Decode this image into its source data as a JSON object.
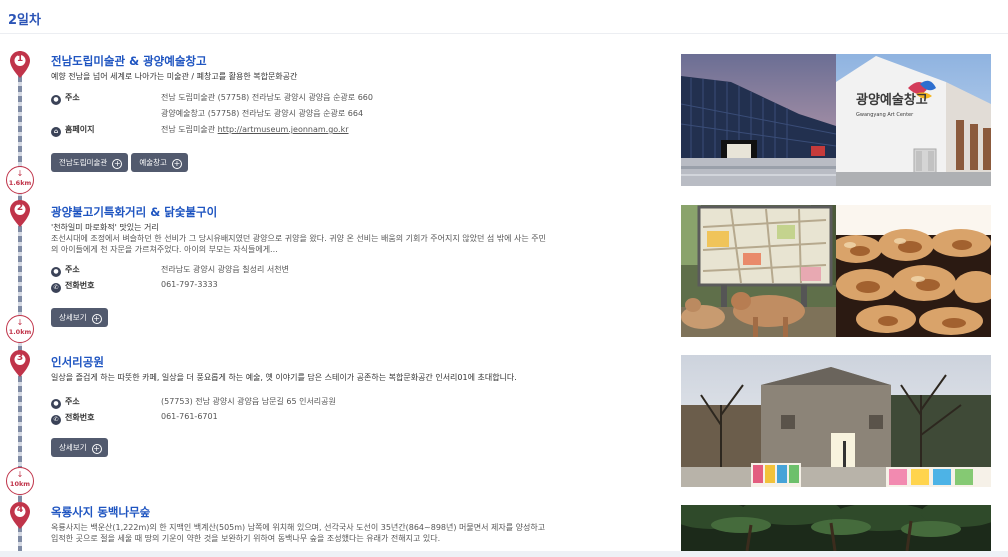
{
  "day_title": "2일차",
  "places": [
    {
      "number": "1",
      "title": "전남도립미술관 & 광양예술창고",
      "subtitle": "예향 전남을 넘어 세계로 나아가는 미술관 / 폐창고를 활용한 복합문화공간",
      "address_label": "주소",
      "address_lines": [
        "전남 도립미술관 (57758) 전라남도 광양시 광양읍 순광로 660",
        "광양예술창고 (57758) 전라남도 광양시 광양읍 순광로 664"
      ],
      "homepage_label": "홈페이지",
      "homepage_prefix": "전남 도립미술관",
      "homepage_url": "http://artmuseum.jeonnam.go.kr",
      "buttons": [
        "전남도립미술관",
        "예술창고"
      ],
      "image_sign_text": "광양예술창고",
      "image_sign_sub": "Gwangyang Art Center"
    },
    {
      "number": "2",
      "title": "광양불고기특화거리 & 닭숯불구이",
      "subtitle": "'천하일미 마로화적' 맛있는 거리",
      "description": "조선시대에 조정에서 벼슬하던 한 선비가 그 당시유배지였던 광양으로 귀양을 왔다. 귀양 온 선비는 배움의 기회가 주어지지 않았던 섬 밖에 사는 주민의 아이들에게 천 자문을 가르쳐주었다. 아이의 부모는 자식들에게...",
      "address_label": "주소",
      "address": "전라남도 광양시 광양읍 칠성리 서천변",
      "phone_label": "전화번호",
      "phone": "061-797-3333",
      "button": "상세보기"
    },
    {
      "number": "3",
      "title": "인서리공원",
      "subtitle": "일상을 즐겁게 하는 따뜻한 카페, 일상을 더 풍요롭게 하는 예술, 옛 이야기를 담은 스테이가 공존하는 복합문화공간 인서리01에 초대합니다.",
      "address_label": "주소",
      "address": "(57753) 전남 광양시 광양읍 남문길 65 인서리공원",
      "phone_label": "전화번호",
      "phone": "061-761-6701",
      "button": "상세보기"
    },
    {
      "number": "4",
      "title": "옥룡사지 동백나무숲",
      "description": "옥룡사지는 백운산(1,222m)의 한 지맥인 백계산(505m) 남쪽에 위치해 있으며, 선각국사 도선이 35년간(864~898년) 머물면서 제자를 양성하고 입적한 곳으로 절을 세울 때 땅의 기운이 약한 것을 보완하기 위하여 동백나무 숲을 조성했다는 유래가 전해지고 있다."
    }
  ],
  "distances": [
    "1.6km",
    "1.0km",
    "10km"
  ],
  "icons": {
    "address": "map-pin-icon",
    "homepage": "home-icon",
    "phone": "phone-icon",
    "plus": "plus-circle-icon",
    "arrow": "arrow-down-icon",
    "marker": "map-marker-icon"
  },
  "colors": {
    "accent_blue": "#1f55c1",
    "marker_red": "#c0344a",
    "button_gray": "#525a6e"
  }
}
